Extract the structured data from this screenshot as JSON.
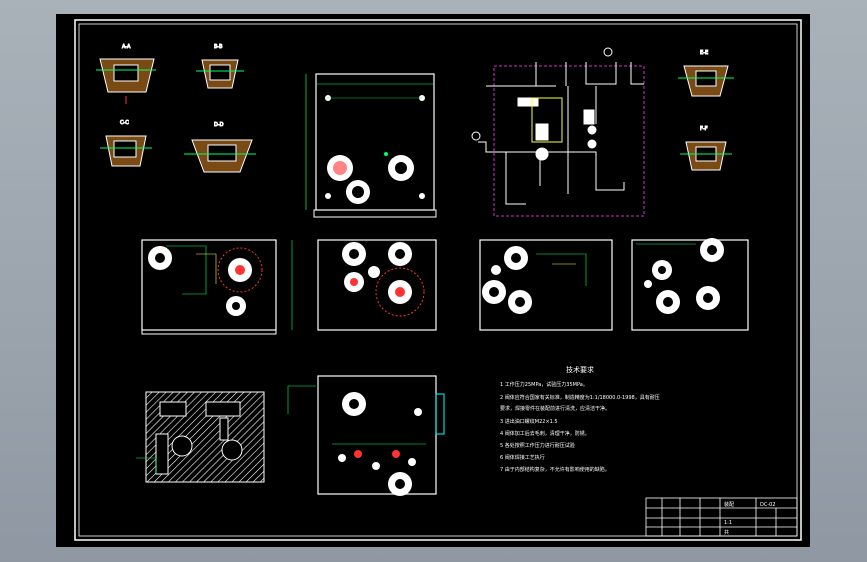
{
  "notes": {
    "title": "技术要求",
    "lines": [
      "1 工作压力25MPa，试验压力35MPa。",
      "2 阀体应符合国家有关标准，制造精度为1:1/18000.0-1998，具有耐压",
      "  要求，焊接零件在装配前进行清洗，应清洁干净。",
      "3 进出油口螺纹M22×1.5",
      "4 阀体加工后去毛刺，清理干净，防锈。",
      "5 各处按照工作压力进行耐压试验",
      "6 阀体焊接工艺执行",
      "7 由于内部结构复杂，不允许有影响使用的缺陷。"
    ]
  },
  "title_block": {
    "company": "装配",
    "drawing_no": "DC-02",
    "scale": "1:1",
    "sheet": "共"
  },
  "views": {
    "section_a": "A-A",
    "section_b": "B-B",
    "section_c": "C-C",
    "section_d": "D-D",
    "section_e": "E-E",
    "section_f": "F-F"
  }
}
